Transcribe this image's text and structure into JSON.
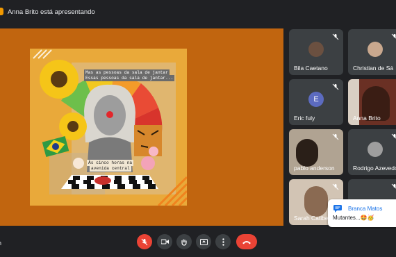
{
  "presenter": {
    "label": "Anna Brito está apresentando"
  },
  "slide": {
    "line1": "Mas as pessoas da sala de jantar",
    "line2": "Essas pessoas da sala de jantar...",
    "caption1": "Às cinco horas na",
    "caption2": "avenida central"
  },
  "participants": [
    {
      "name": "Bila Caetano",
      "type": "photo",
      "color": "#6b5040"
    },
    {
      "name": "Christian de Sá",
      "type": "photo",
      "color": "#c9a88e"
    },
    {
      "name": "Eric fuly",
      "type": "initial",
      "initial": "E",
      "color": "#5c6bc0"
    },
    {
      "name": "Anna Brito",
      "type": "video",
      "color": "#7a3a2a"
    },
    {
      "name": "pablo anderson",
      "type": "video",
      "color": "#9a8a78"
    },
    {
      "name": "Rodrigo Azevedo",
      "type": "photo",
      "color": "#9e9e9e"
    },
    {
      "name": "Sarah Catibe",
      "type": "video",
      "color": "#c8b8a8"
    },
    {
      "name": "",
      "type": "photo",
      "color": "#3c4043"
    }
  ],
  "chat_popup": {
    "sender": "Branca Matos",
    "message": "Mutantes...🤩🥳"
  },
  "bottom": {
    "left_text": "h"
  },
  "colors": {
    "stage": "#c1650f",
    "slide_bg": "#e9a93a",
    "red": "#ea4335",
    "blue": "#1a73e8"
  },
  "controls": [
    "mic-off-icon",
    "camera-icon",
    "raise-hand-icon",
    "present-icon",
    "more-icon",
    "end-call-icon"
  ]
}
